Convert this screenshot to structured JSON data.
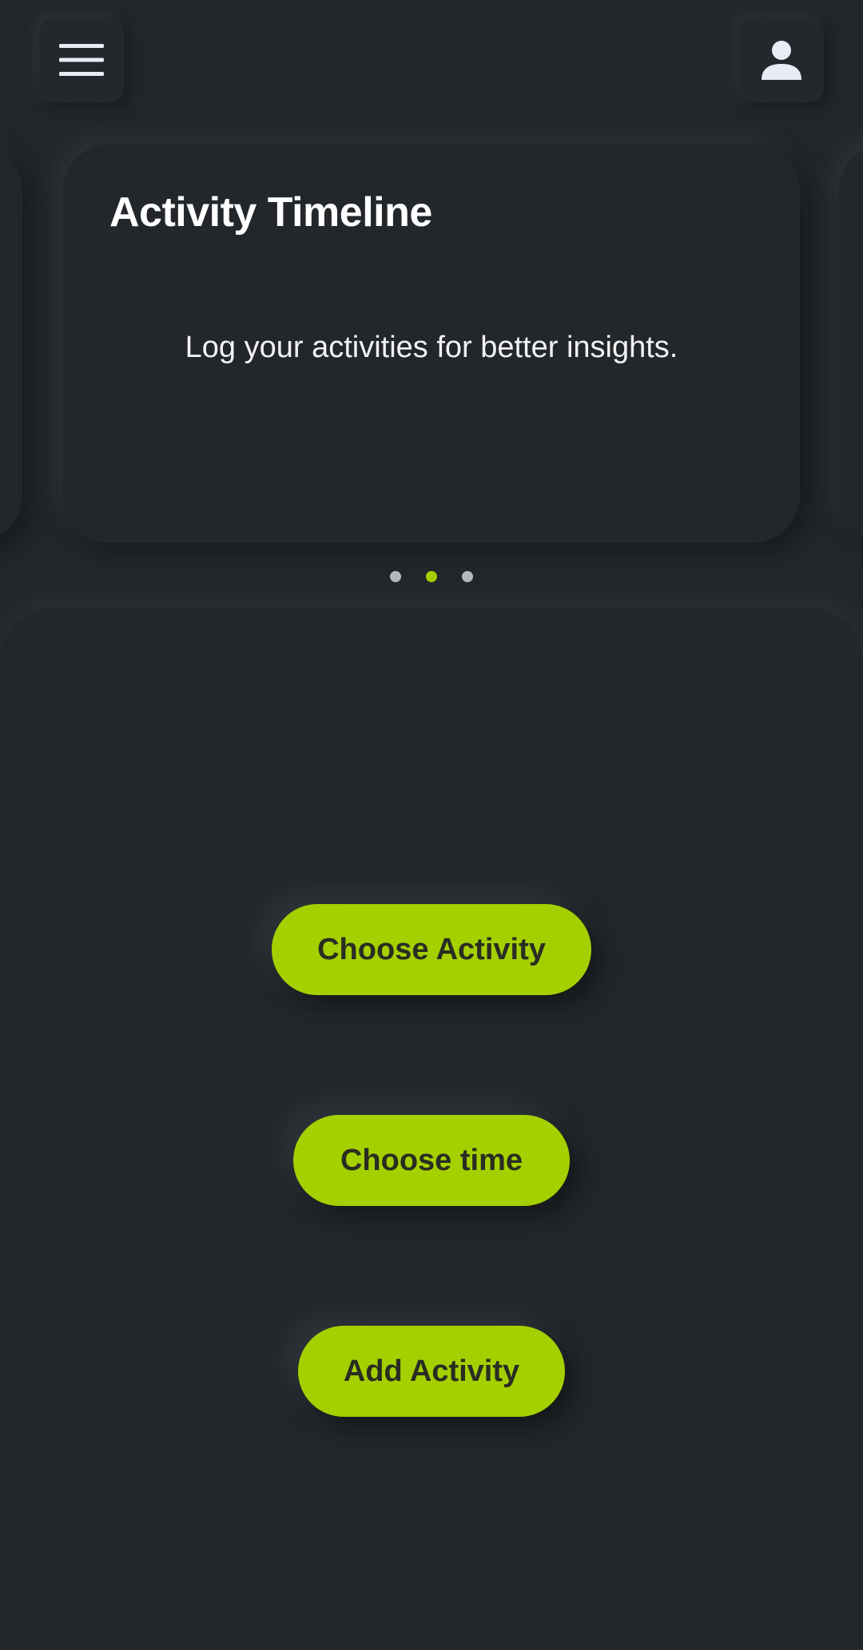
{
  "header": {
    "menu_icon": "hamburger-menu-icon",
    "profile_icon": "person-icon"
  },
  "carousel": {
    "active_index": 1,
    "page_count": 3,
    "card": {
      "title": "Activity Timeline",
      "body": "Log your activities for better insights."
    }
  },
  "actions": {
    "choose_activity": "Choose Activity",
    "choose_time": "Choose time",
    "add_activity": "Add Activity"
  },
  "colors": {
    "background": "#23272c",
    "accent": "#a4d000",
    "button_text": "#2a2d22",
    "icon": "#e9ebf5",
    "dot_inactive": "#b5b8bc"
  }
}
